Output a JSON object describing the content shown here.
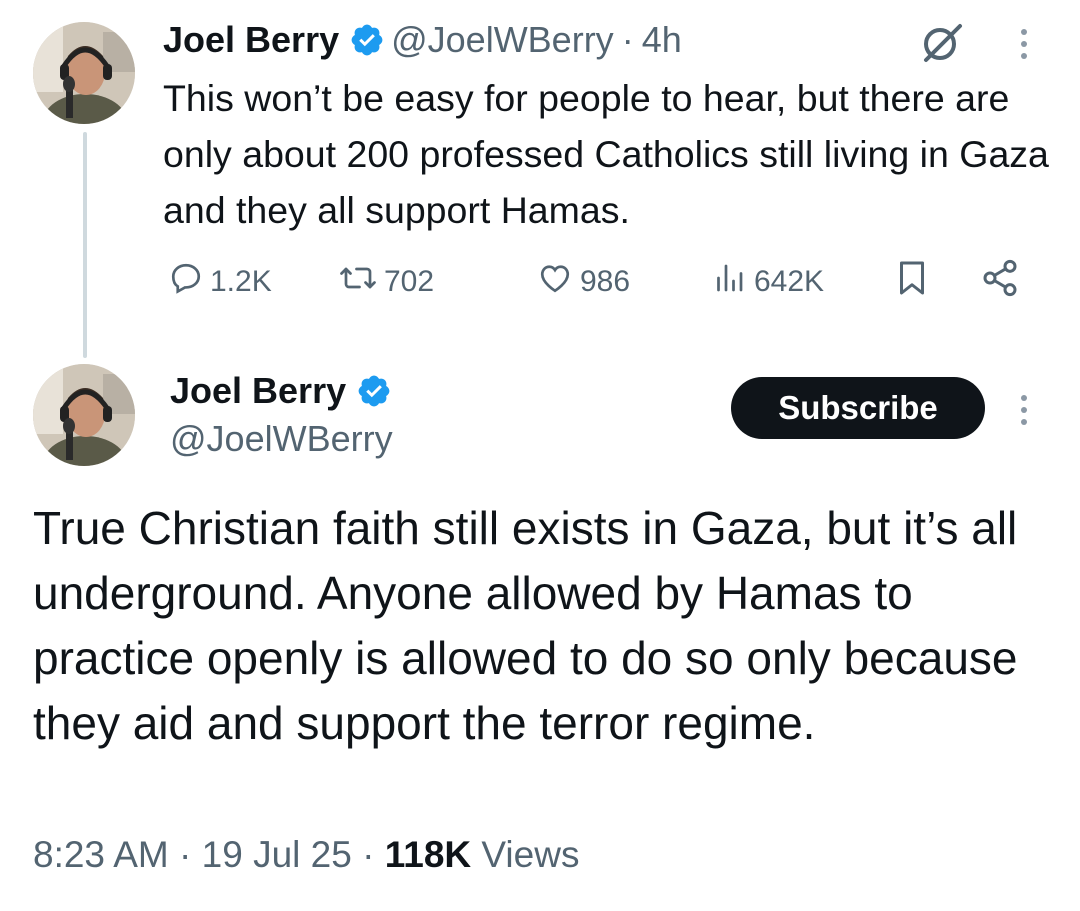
{
  "parent_tweet": {
    "author_name": "Joel Berry",
    "handle": "@JoelWBerry",
    "separator": "·",
    "time": "4h",
    "text": "This won’t be easy for people to hear, but there are only about 200 professed Catholics still living in Gaza and they all support Hamas.",
    "metrics": {
      "replies": "1.2K",
      "reposts": "702",
      "likes": "986",
      "views": "642K"
    }
  },
  "main_tweet": {
    "author_name": "Joel Berry",
    "handle": "@JoelWBerry",
    "subscribe_label": "Subscribe",
    "text": "True Christian faith still exists in Gaza, but it’s all underground. Anyone allowed by Hamas to practice openly is allowed to do so only because they aid and support the terror regime.",
    "time": "8:23 AM",
    "date": "19 Jul 25",
    "separator": "·",
    "views_count": "118K",
    "views_label": "Views"
  },
  "colors": {
    "verified_blue": "#1d9bf0",
    "text_primary": "#0f1419",
    "text_secondary": "#536471",
    "thread_line": "#cfd9de",
    "subscribe_bg": "#0f1419"
  },
  "icons": [
    "verified-badge-icon",
    "grok-icon",
    "more-options-icon",
    "reply-icon",
    "repost-icon",
    "like-icon",
    "views-icon",
    "bookmark-icon",
    "share-icon"
  ]
}
